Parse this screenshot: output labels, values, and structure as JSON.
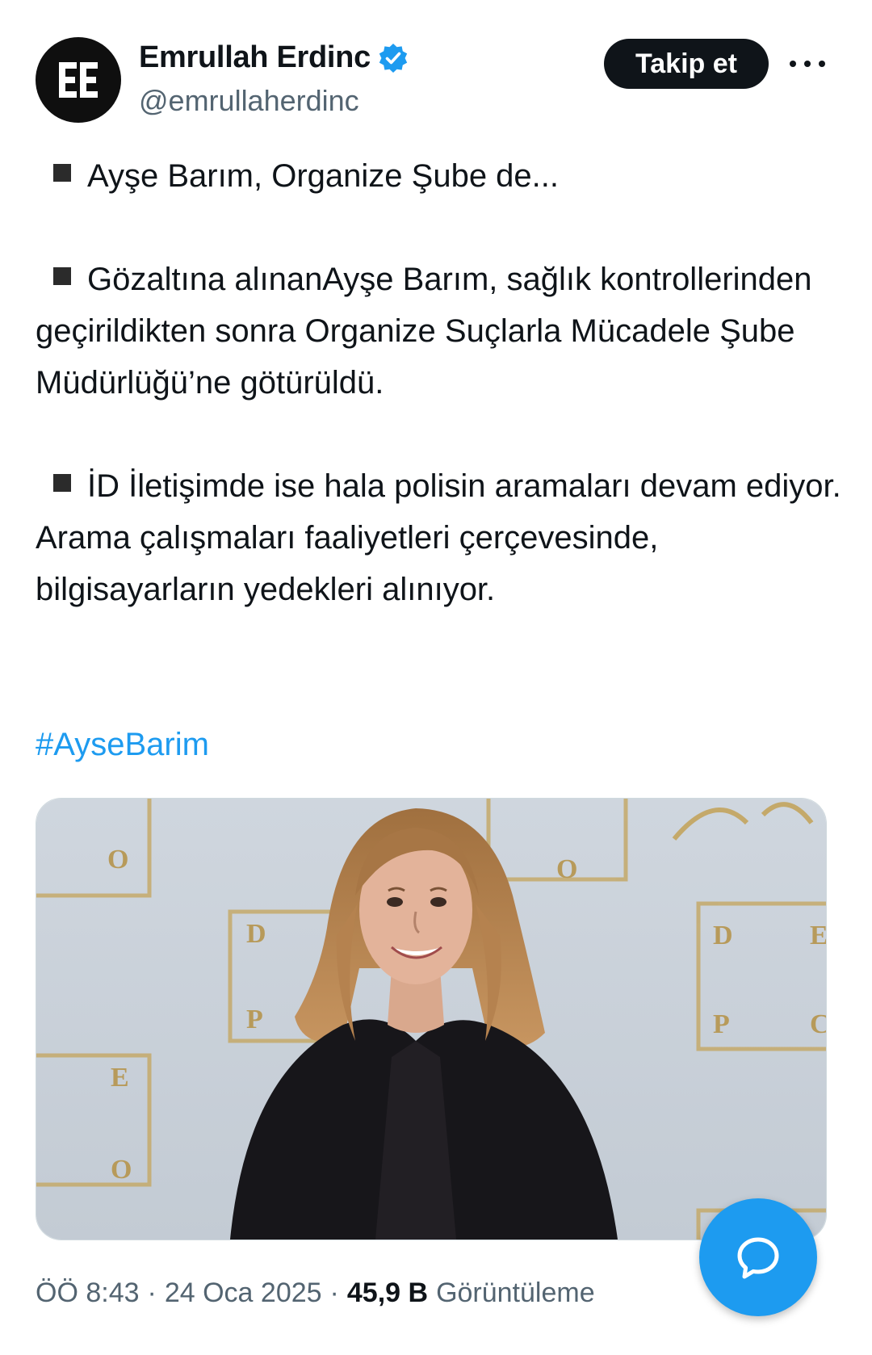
{
  "header": {
    "author_name": "Emrullah Erdinc",
    "author_handle": "@emrullaherdinc",
    "follow_label": "Takip et",
    "avatar_icon": "ee-logo-icon",
    "verified_icon": "verified-badge-icon",
    "more_icon": "more-options-icon"
  },
  "tweet": {
    "paragraphs": [
      "Ayşe Barım, Organize Şube de...",
      "Gözaltına alınanAyşe Barım, sağlık kontrollerinden geçirildikten sonra Organize Suçlarla Mücadele Şube Müdürlüğü’ne götürüldü.",
      "İD İletişimde ise hala polisin aramaları devam ediyor. Arama çalışmaları faaliyetleri çerçevesinde, bilgisayarların yedekleri alınıyor."
    ],
    "hashtag": "#AyseBarim"
  },
  "meta": {
    "time": "ÖÖ 8:43",
    "separator": "·",
    "date": "24 Oca 2025",
    "views_count": "45,9 B",
    "views_label": "Görüntüleme"
  },
  "fab": {
    "icon": "compose-reply-icon"
  },
  "colors": {
    "accent": "#1d9bf0",
    "text": "#0f1419",
    "muted": "#536471",
    "follow_bg": "#0f1419"
  }
}
